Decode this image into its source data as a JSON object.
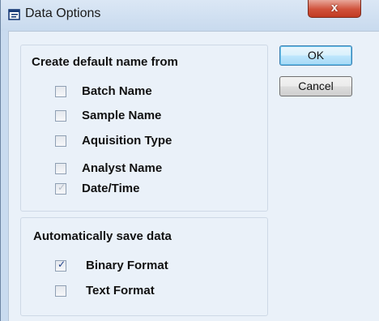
{
  "window": {
    "title": "Data Options",
    "close_label": "x"
  },
  "buttons": {
    "ok": "OK",
    "cancel": "Cancel"
  },
  "name_group": {
    "title": "Create default name from",
    "options": [
      {
        "label": "Batch Name",
        "checked": false,
        "enabled": true
      },
      {
        "label": "Sample Name",
        "checked": false,
        "enabled": true
      },
      {
        "label": "Aquisition Type",
        "checked": false,
        "enabled": true
      },
      {
        "label": "Analyst Name",
        "checked": false,
        "enabled": true
      },
      {
        "label": "Date/Time",
        "checked": true,
        "enabled": false
      }
    ]
  },
  "save_group": {
    "title": "Automatically save data",
    "options": [
      {
        "label": "Binary Format",
        "checked": true,
        "enabled": true
      },
      {
        "label": "Text Format",
        "checked": false,
        "enabled": true
      }
    ]
  },
  "colors": {
    "frame": "#c9dbef",
    "client": "#eaf1f9",
    "close_button": "#c94a33",
    "default_button_border": "#3c7fb1"
  }
}
